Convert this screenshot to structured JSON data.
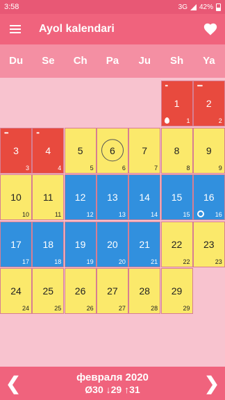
{
  "status": {
    "time": "3:58",
    "network": "3G",
    "battery": "42%"
  },
  "app": {
    "title": "Ayol kalendari"
  },
  "weekdays": [
    "Du",
    "Se",
    "Ch",
    "Pa",
    "Ju",
    "Sh",
    "Ya"
  ],
  "days": [
    {
      "n": "1",
      "small": "1",
      "type": "red",
      "dots": "••",
      "mark": "drop"
    },
    {
      "n": "2",
      "small": "2",
      "type": "red",
      "dots": "••••"
    },
    {
      "n": "3",
      "small": "3",
      "type": "red",
      "dots": "•••"
    },
    {
      "n": "4",
      "small": "4",
      "type": "red",
      "dots": "••"
    },
    {
      "n": "5",
      "small": "5",
      "type": "yellow"
    },
    {
      "n": "6",
      "small": "6",
      "type": "yellow",
      "today": true
    },
    {
      "n": "7",
      "small": "7",
      "type": "yellow"
    },
    {
      "n": "8",
      "small": "8",
      "type": "yellow"
    },
    {
      "n": "9",
      "small": "9",
      "type": "yellow"
    },
    {
      "n": "10",
      "small": "10",
      "type": "yellow"
    },
    {
      "n": "11",
      "small": "11",
      "type": "yellow"
    },
    {
      "n": "12",
      "small": "12",
      "type": "blue"
    },
    {
      "n": "13",
      "small": "13",
      "type": "blue"
    },
    {
      "n": "14",
      "small": "14",
      "type": "blue"
    },
    {
      "n": "15",
      "small": "15",
      "type": "blue"
    },
    {
      "n": "16",
      "small": "16",
      "type": "blue",
      "mark": "ring"
    },
    {
      "n": "17",
      "small": "17",
      "type": "blue"
    },
    {
      "n": "18",
      "small": "18",
      "type": "blue"
    },
    {
      "n": "19",
      "small": "19",
      "type": "blue"
    },
    {
      "n": "20",
      "small": "20",
      "type": "blue"
    },
    {
      "n": "21",
      "small": "21",
      "type": "blue"
    },
    {
      "n": "22",
      "small": "22",
      "type": "yellow"
    },
    {
      "n": "23",
      "small": "23",
      "type": "yellow"
    },
    {
      "n": "24",
      "small": "24",
      "type": "yellow"
    },
    {
      "n": "25",
      "small": "25",
      "type": "yellow"
    },
    {
      "n": "26",
      "small": "26",
      "type": "yellow"
    },
    {
      "n": "27",
      "small": "27",
      "type": "yellow"
    },
    {
      "n": "28",
      "small": "28",
      "type": "yellow"
    },
    {
      "n": "29",
      "small": "29",
      "type": "yellow"
    }
  ],
  "footer": {
    "month": "февраля 2020",
    "stats": "Ø30 ↓29 ↑31",
    "prev_icon": "chevron-left-icon",
    "next_icon": "chevron-right-icon"
  },
  "colors": {
    "red": "#e84a3e",
    "yellow": "#fbe96b",
    "blue": "#3190de",
    "appbar": "#f0637d",
    "background": "#f8c3cf"
  }
}
